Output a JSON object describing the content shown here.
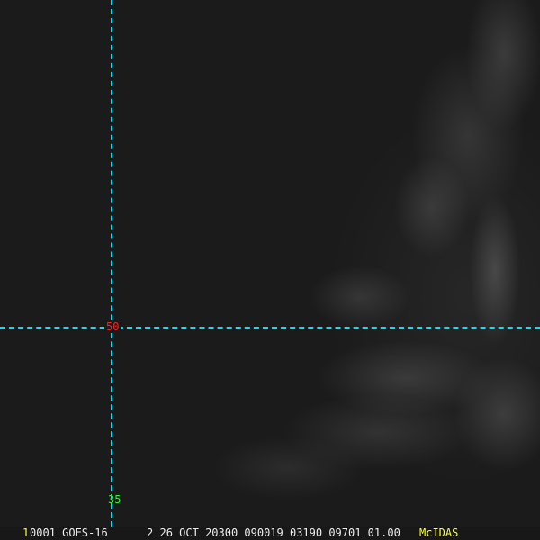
{
  "overlay": {
    "latitude_label": "50",
    "longitude_label": "35",
    "line_color": "#00e5ff"
  },
  "status_bar": {
    "frame_number": "1",
    "info": "0001 GOES-16      2 26 OCT 20300 090019 03190 09701 01.00",
    "brand": "McIDAS"
  }
}
